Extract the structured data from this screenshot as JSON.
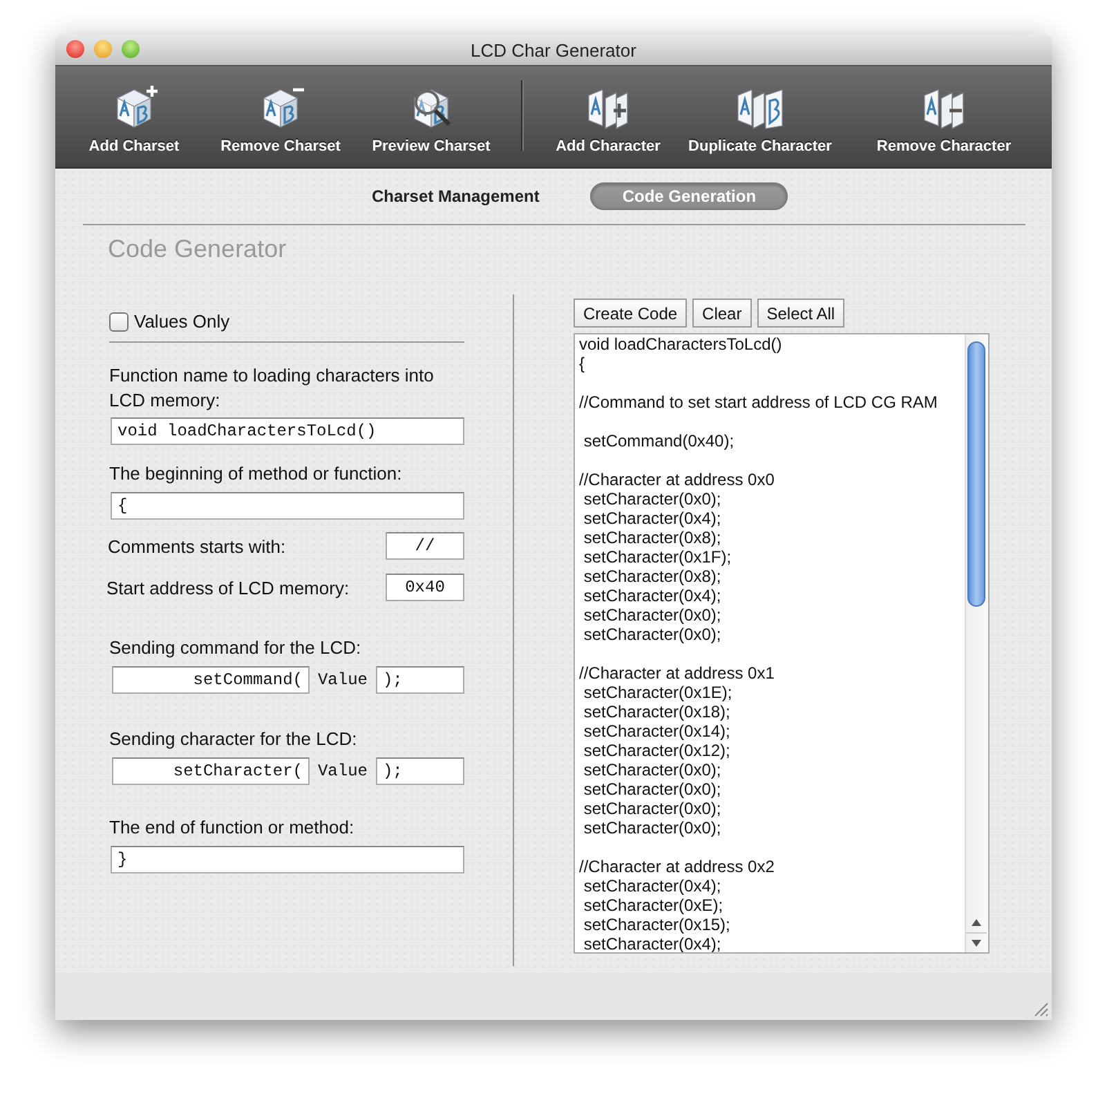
{
  "window": {
    "title": "LCD Char Generator"
  },
  "toolbar": {
    "groups": [
      [
        {
          "label": "Add Charset",
          "kind": "add-set"
        },
        {
          "label": "Remove Charset",
          "kind": "remove-set"
        },
        {
          "label": "Preview Charset",
          "kind": "preview-set"
        }
      ],
      [
        {
          "label": "Add Character",
          "kind": "add-char"
        },
        {
          "label": "Duplicate Character",
          "kind": "duplicate-char"
        },
        {
          "label": "Remove Character",
          "kind": "remove-char"
        }
      ]
    ]
  },
  "tabs": [
    {
      "label": "Charset Management",
      "selected": false
    },
    {
      "label": "Code Generation",
      "selected": true
    }
  ],
  "section_title": "Code Generator",
  "form": {
    "values_only": {
      "label": "Values Only",
      "checked": false
    },
    "function_name": {
      "label": "Function name to loading characters into LCD memory:",
      "value": "void loadCharactersToLcd()"
    },
    "begin": {
      "label": "The beginning of method or function:",
      "value": "{"
    },
    "comment_prefix": {
      "label": "Comments starts with:",
      "value": "//"
    },
    "start_address": {
      "label": "Start address of LCD memory:",
      "value": "0x40"
    },
    "command": {
      "label": "Sending command for the LCD:",
      "prefix": "setCommand(",
      "middle": "Value",
      "suffix": ");"
    },
    "character": {
      "label": "Sending character for the LCD:",
      "prefix": "setCharacter(",
      "middle": "Value",
      "suffix": ");"
    },
    "end": {
      "label": "The end of function or method:",
      "value": "}"
    }
  },
  "buttons": [
    "Create Code",
    "Clear",
    "Select All"
  ],
  "code_blocks": [
    [
      "void loadCharactersToLcd()",
      "{"
    ],
    [
      "//Command to set start address of LCD CG RAM"
    ],
    [
      " setCommand(0x40);"
    ],
    [
      "//Character at address 0x0",
      " setCharacter(0x0);",
      " setCharacter(0x4);",
      " setCharacter(0x8);",
      " setCharacter(0x1F);",
      " setCharacter(0x8);",
      " setCharacter(0x4);",
      " setCharacter(0x0);",
      " setCharacter(0x0);"
    ],
    [
      "//Character at address 0x1",
      " setCharacter(0x1E);",
      " setCharacter(0x18);",
      " setCharacter(0x14);",
      " setCharacter(0x12);",
      " setCharacter(0x0);",
      " setCharacter(0x0);",
      " setCharacter(0x0);",
      " setCharacter(0x0);"
    ],
    [
      "//Character at address 0x2",
      " setCharacter(0x4);",
      " setCharacter(0xE);",
      " setCharacter(0x15);",
      " setCharacter(0x4);"
    ]
  ]
}
